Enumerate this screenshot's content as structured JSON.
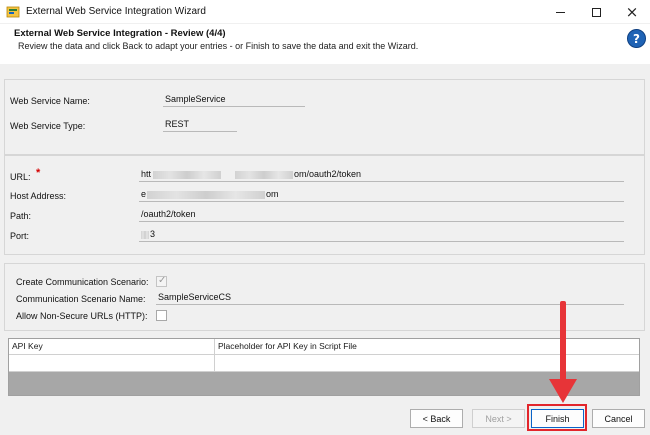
{
  "window": {
    "title": "External Web Service Integration Wizard",
    "minimize": "minimize",
    "maximize": "maximize",
    "close": "×"
  },
  "header": {
    "title": "External Web Service Integration - Review (4/4)",
    "subtitle": "Review the data and click Back to adapt your entries - or Finish to save the data and exit the Wizard.",
    "help": "?"
  },
  "service": {
    "name_label": "Web Service Name:",
    "name_value": "SampleService",
    "type_label": "Web Service Type:",
    "type_value": "REST"
  },
  "connection": {
    "url_label": "URL:",
    "required_marker": "*",
    "url_prefix": "htt",
    "url_suffix": "om/oauth2/token",
    "host_label": "Host Address:",
    "host_prefix": "e",
    "host_suffix": "om",
    "path_label": "Path:",
    "path_value": "/oauth2/token",
    "port_label": "Port:",
    "port_value": "3"
  },
  "communication": {
    "create_label": "Create Communication Scenario:",
    "create_checked": true,
    "name_label": "Communication Scenario Name:",
    "name_value": "SampleServiceCS",
    "nonsecure_label": "Allow Non-Secure URLs (HTTP):",
    "nonsecure_checked": false
  },
  "api_table": {
    "columns": [
      "API Key",
      "Placeholder for API Key in Script File"
    ],
    "rows": [
      [
        "",
        ""
      ]
    ]
  },
  "buttons": {
    "back": "< Back",
    "next": "Next >",
    "finish": "Finish",
    "cancel": "Cancel"
  },
  "colors": {
    "annotation": "#e73438",
    "help_icon": "#1f63b5"
  }
}
